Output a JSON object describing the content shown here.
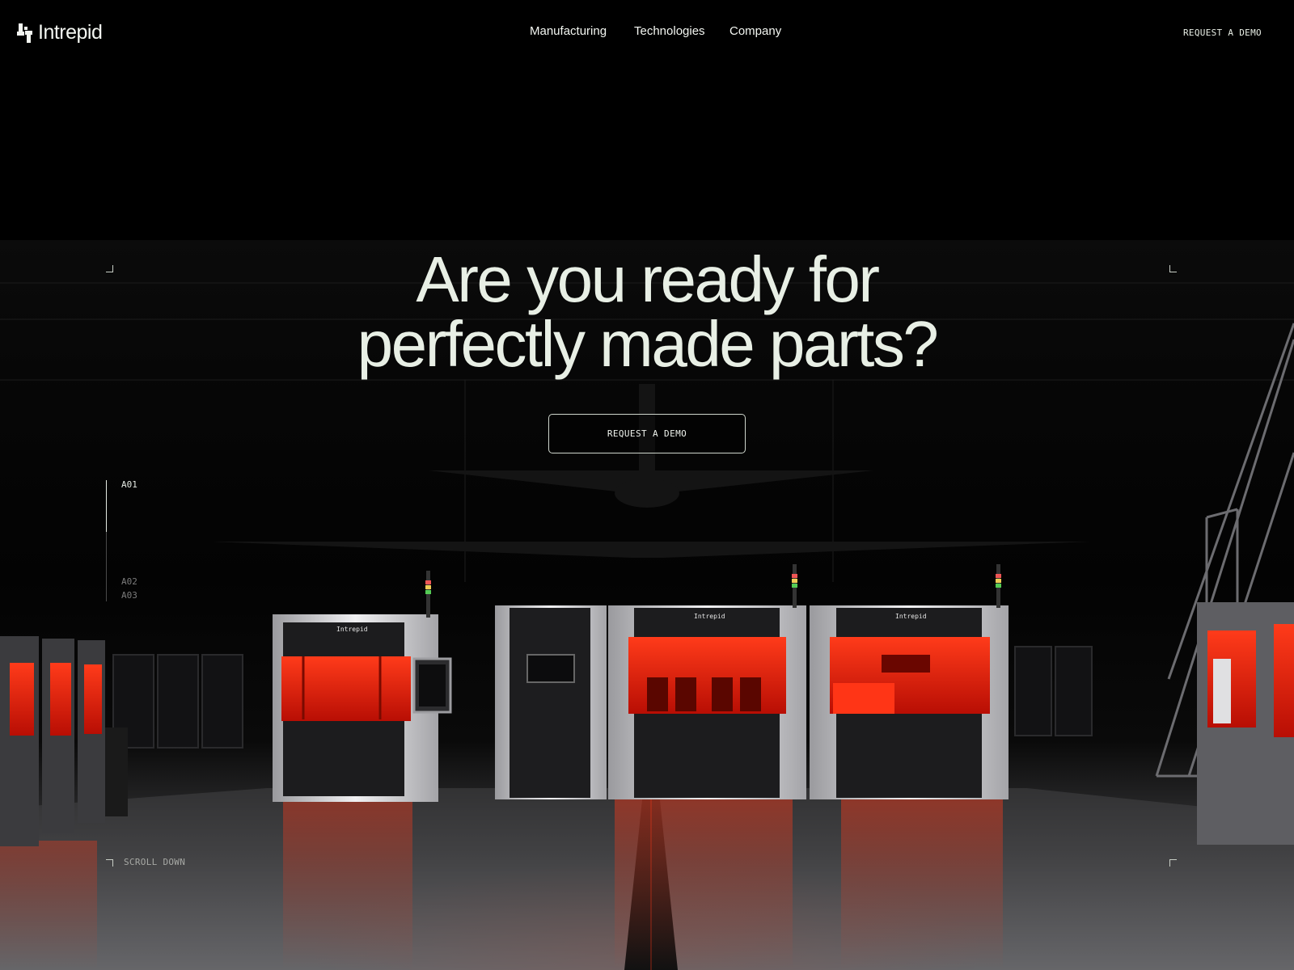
{
  "brand": {
    "name": "Intrepid",
    "machine_label": "Intrepid"
  },
  "nav": {
    "items": [
      {
        "label": "Manufacturing"
      },
      {
        "label": "Technologies"
      },
      {
        "label": "Company"
      }
    ],
    "cta_label": "REQUEST A DEMO"
  },
  "hero": {
    "headline_line1": "Are you ready for",
    "headline_line2": "perfectly made parts?",
    "cta_label": "REQUEST A DEMO",
    "scroll_label": "SCROLL DOWN"
  },
  "section_index": {
    "items": [
      {
        "label": "A01",
        "active": true
      },
      {
        "label": "A02",
        "active": false
      },
      {
        "label": "A03",
        "active": false
      }
    ]
  },
  "colors": {
    "background": "#000000",
    "text": "#e8efe5",
    "accent_glow": "#ff2a12",
    "machine_body": "#1c1c1e",
    "machine_frame": "#d9d9dc"
  }
}
